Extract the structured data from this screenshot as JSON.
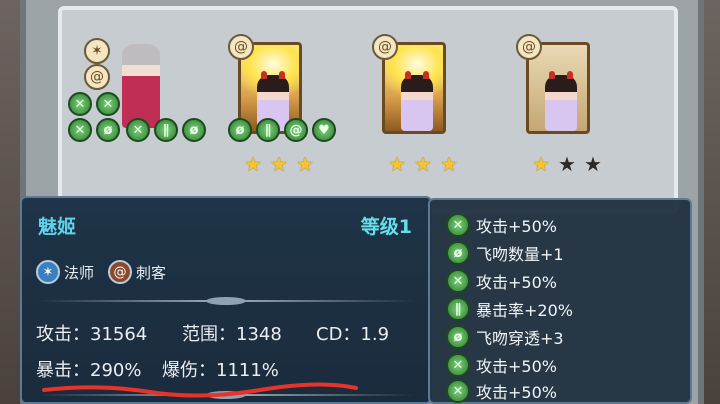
{
  "roster": {
    "cards": [
      {
        "class_icons": [
          "staff-icon",
          "swirl-icon"
        ],
        "skill_icons": [
          "x-icon",
          "x-icon",
          "x-icon",
          "slash-circle-icon",
          "x-icon",
          "double-slash-icon",
          "slash-circle-icon"
        ],
        "stars": null
      },
      {
        "class_icon": "swirl-icon",
        "skill_icons": [
          "slash-circle-icon",
          "double-slash-icon",
          "swirl-icon",
          "kiss-icon"
        ],
        "stars": {
          "filled": 3,
          "total": 3
        }
      },
      {
        "class_icon": "swirl-icon",
        "stars": {
          "filled": 3,
          "total": 3
        }
      },
      {
        "class_icon": "swirl-icon",
        "stars": {
          "filled": 1,
          "total": 3
        }
      }
    ]
  },
  "hero": {
    "name": "魅姬",
    "level_label": "等级1",
    "classes": [
      {
        "label": "法师",
        "icon": "staff-icon",
        "color": "#3a7fc0"
      },
      {
        "label": "刺客",
        "icon": "swirl-icon",
        "color": "#8a4a2a"
      }
    ],
    "stats": {
      "attack": "攻击：31564",
      "range": "范围：1348",
      "cd": "CD：1.9",
      "crit": "暴击：290%",
      "crit_damage": "爆伤：1111%"
    }
  },
  "bonuses": [
    {
      "icon": "x-icon",
      "text": "攻击+50%"
    },
    {
      "icon": "slash-circle-icon",
      "text": "飞吻数量+1"
    },
    {
      "icon": "x-icon",
      "text": "攻击+50%"
    },
    {
      "icon": "double-slash-icon",
      "text": "暴击率+20%"
    },
    {
      "icon": "slash-circle-icon",
      "text": "飞吻穿透+3"
    },
    {
      "icon": "x-icon",
      "text": "攻击+50%"
    },
    {
      "icon": "x-icon",
      "text": "攻击+50%"
    }
  ],
  "colors": {
    "name": "#5fd3ea",
    "level": "#66e0e8",
    "annotation_underline": "#e8332a",
    "star_on": "#f5c430",
    "star_off": "#2d2a28"
  }
}
